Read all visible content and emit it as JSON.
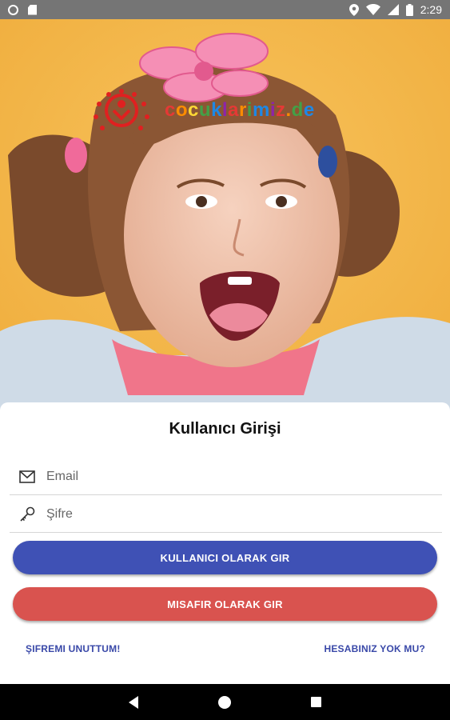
{
  "status_bar": {
    "time": "2:29",
    "left_icons": [
      "notification-circle-icon",
      "sd-card-icon"
    ],
    "right_icons": [
      "location-icon",
      "wifi-icon",
      "signal-icon",
      "battery-icon"
    ]
  },
  "hero": {
    "logo_text": "cocuklarimiz.de",
    "logo_icon": "family-emblem-icon"
  },
  "login": {
    "title": "Kullanıcı Girişi",
    "email_placeholder": "Email",
    "email_value": "",
    "password_placeholder": "Şifre",
    "password_value": "",
    "user_login_label": "KULLANICI OLARAK GIR",
    "guest_login_label": "MISAFIR OLARAK GIR",
    "forgot_password_label": "ŞIFREMI UNUTTUM!",
    "no_account_label": "HESABINIZ YOK MU?"
  },
  "colors": {
    "primary_button": "#3f51b5",
    "guest_button": "#d9534f",
    "link": "#3948a8",
    "background": "#f5b94a"
  },
  "nav_bar": {
    "icons": [
      "back-icon",
      "home-icon",
      "recents-icon"
    ]
  }
}
